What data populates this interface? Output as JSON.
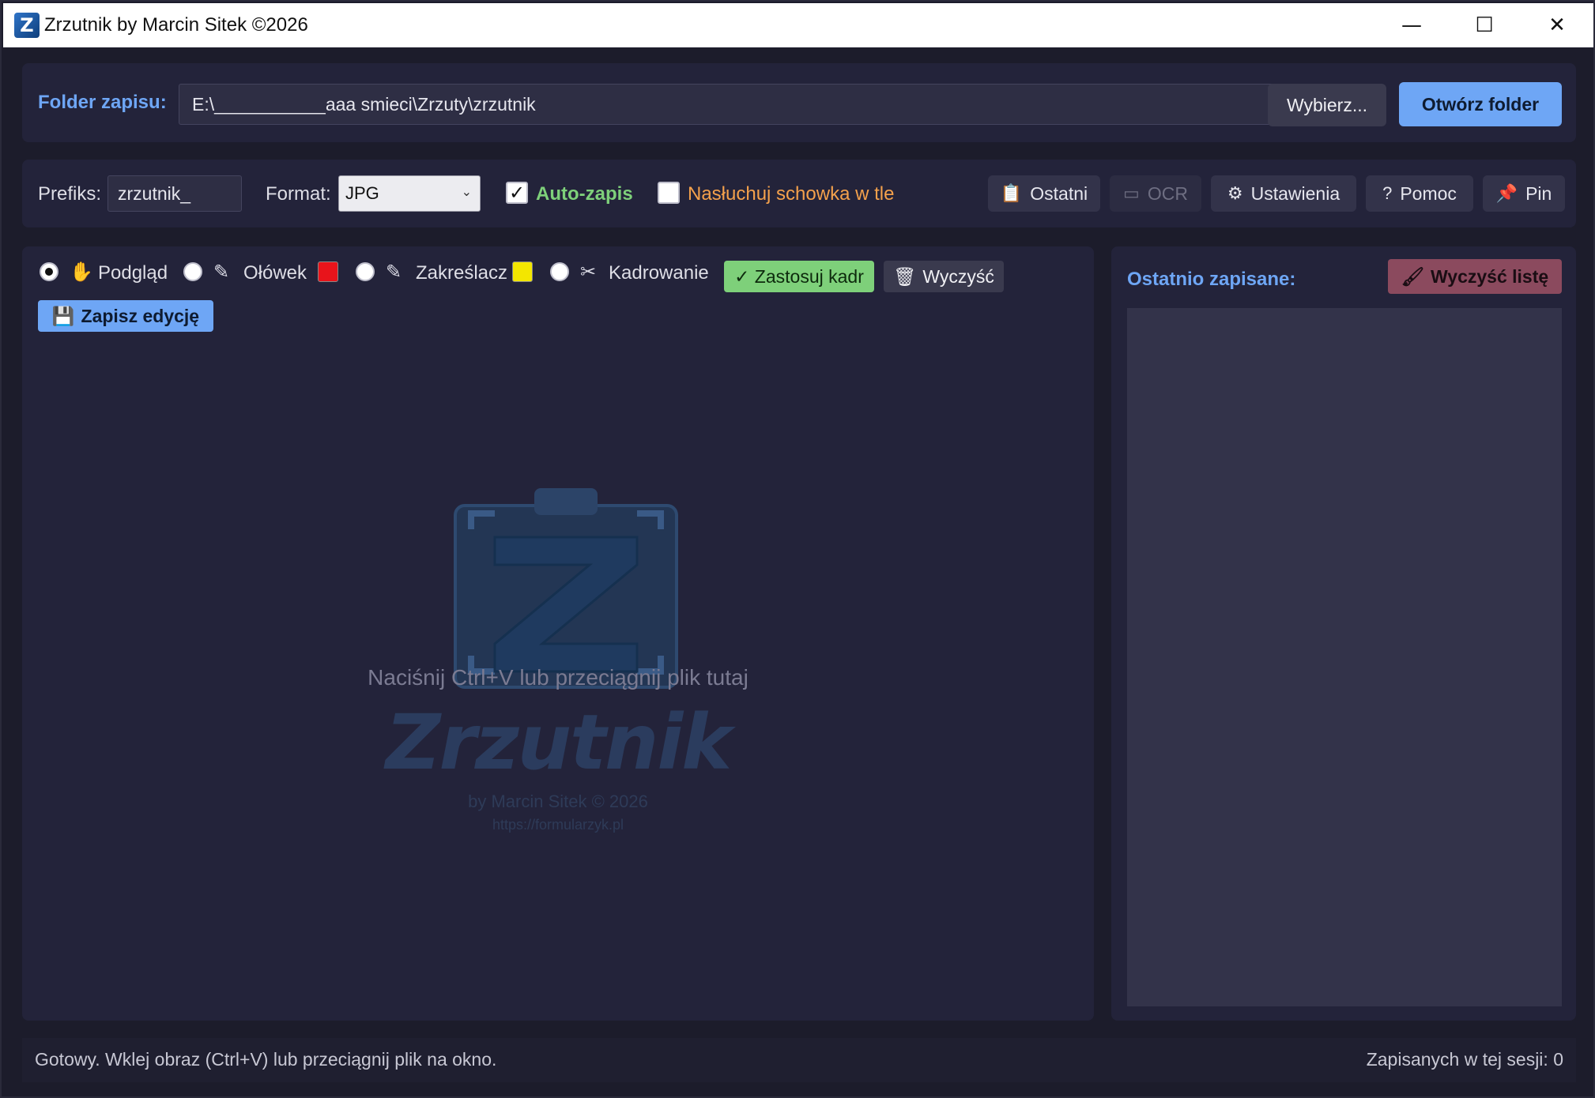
{
  "window": {
    "title": "Zrzutnik by Marcin Sitek ©2026",
    "app_icon_glyph": "Z",
    "minimize_glyph": "—",
    "maximize_glyph": "☐",
    "close_glyph": "✕"
  },
  "folder_row": {
    "label": "Folder zapisu:",
    "path_value": "E:\\___________aaa smieci\\Zrzuty\\zrzutnik",
    "choose_label": "Wybierz...",
    "open_label": "Otwórz folder"
  },
  "options_row": {
    "prefix_label": "Prefiks:",
    "prefix_value": "zrzutnik_",
    "format_label": "Format:",
    "format_value": "JPG",
    "auto_save_label": "Auto-zapis",
    "auto_save_checked": true,
    "listen_label": "Nasłuchuj schowka w tle",
    "listen_checked": false,
    "buttons": {
      "recent": "Ostatni",
      "ocr": "OCR",
      "settings": "Ustawienia",
      "help": "Pomoc",
      "pin": "Pin"
    }
  },
  "editor": {
    "modes": {
      "preview": "Podgląd",
      "pencil": "Ołówek",
      "highlighter": "Zakreślacz",
      "crop": "Kadrowanie"
    },
    "selected_mode": "preview",
    "pencil_color": "#e8141b",
    "highlighter_color": "#f3e600",
    "apply_crop_label": "✓ Zastosuj kadr",
    "clear_label": "Wyczyść",
    "save_edit_label": "Zapisz edycję",
    "drop_hint": "Naciśnij Ctrl+V lub przeciągnij plik tutaj",
    "logo_word": "Zrzutnik",
    "logo_by": "by Marcin Sitek © 2026",
    "logo_url": "https://formularzyk.pl"
  },
  "recent_panel": {
    "title": "Ostatnio zapisane:",
    "clear_list_label": "Wyczyść listę",
    "items": []
  },
  "status_bar": {
    "left": "Gotowy. Wklej obraz (Ctrl+V) lub przeciągnij plik na okno.",
    "right": "Zapisanych w tej sesji: 0"
  },
  "colors": {
    "accent_blue": "#6ea6f5",
    "accent_green": "#7ed07a",
    "accent_orange": "#f4a14c",
    "danger": "#8b4a5e",
    "background": "#1c1c2b"
  }
}
